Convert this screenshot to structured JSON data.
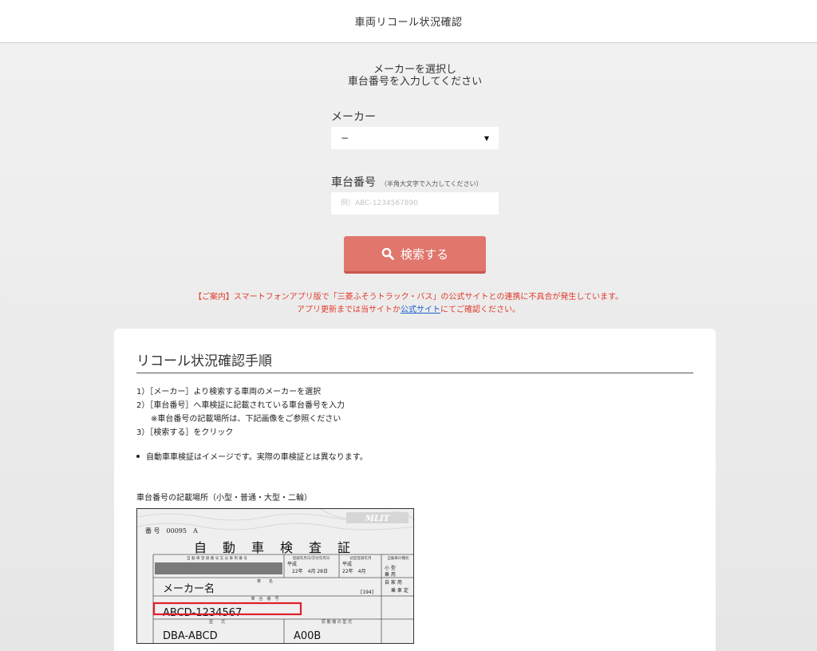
{
  "header": {
    "title": "車両リコール状況確認"
  },
  "form": {
    "instruction_line1": "メーカーを選択し",
    "instruction_line2": "車台番号を入力してください",
    "maker_label": "メーカー",
    "maker_selected": "−",
    "chassis_label": "車台番号",
    "chassis_hint": "（半角大文字で入力してください）",
    "chassis_placeholder": "例）ABC-1234567890",
    "search_label": "検索する"
  },
  "notice": {
    "line1": "【ご案内】スマートフォンアプリ版で「三菱ふそうトラック・バス」の公式サイトとの連携に不具合が発生しています。",
    "line2_before": "アプリ更新までは当サイトか",
    "line2_link": "公式サイト",
    "line2_after": "にてご確認ください。"
  },
  "guide": {
    "title": "リコール状況確認手順",
    "steps": [
      "1）［メーカー］より検索する車両のメーカーを選択",
      "2）［車台番号］へ車検証に記載されている車台番号を入力",
      "※車台番号の記載場所は、下記画像をご参照ください",
      "3）［検索する］をクリック"
    ],
    "bullet": "自動車車検証はイメージです。実際の車検証とは異なります。",
    "caption": "車台番号の記載場所（小型・普通・大型・二輪）"
  },
  "certificate": {
    "number": "番 号　00095　A",
    "title": "自　動　車　検　査　証",
    "small_header_1": "自 動 車 登 録 番 号 又 は 車 両 番 号",
    "small_header_2": "登録年月日/交付年月日",
    "small_header_3": "初度登録年月",
    "small_header_4": "自動車の種別",
    "era_1": "平成",
    "date_1": "22年　4月 28日",
    "era_2": "平成",
    "date_2": "22年　4月",
    "kind": "小 型",
    "use": "乗 用",
    "body": "自 家 用",
    "shape": "乗 車 定",
    "field_name": "車　　名",
    "maker_name": "メーカー名",
    "code_194": "[194]",
    "field_chassis": "車　台　番　号",
    "chassis_value": "ABCD-1234567",
    "field_model": "型　　式",
    "field_engine": "原 動 機 の 型 式",
    "model_value": "DBA-ABCD",
    "engine_value": "A00B",
    "mlit": "MLIT"
  },
  "colors": {
    "button": "#e0766c",
    "notice": "#e03a2a",
    "link": "#1a5fd0",
    "highlight": "#e0202a"
  }
}
